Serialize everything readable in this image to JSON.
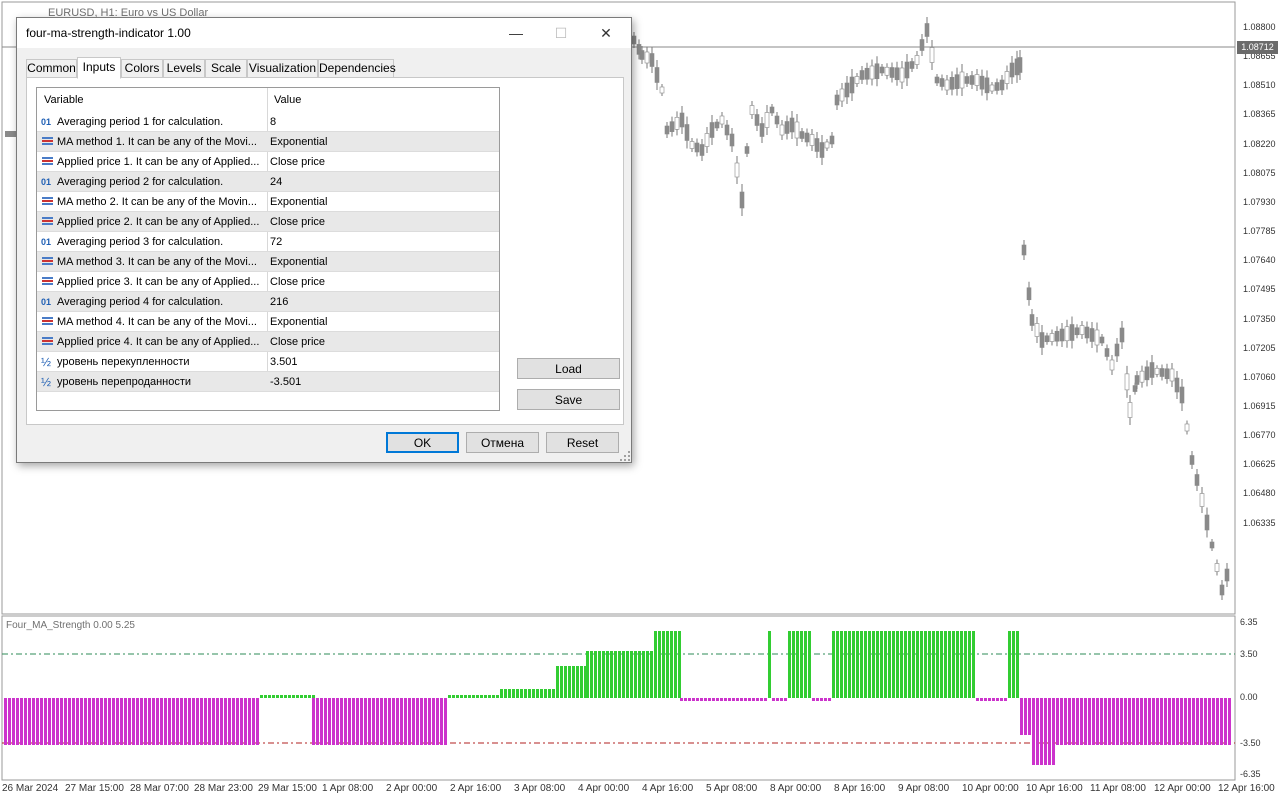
{
  "window": {
    "title": "EURUSD, H1:  Euro vs US Dollar"
  },
  "dialog": {
    "title": "four-ma-strength-indicator 1.00",
    "controls": {
      "minimize": "—",
      "maximize": "☐",
      "close": "✕"
    },
    "tabs": [
      "Common",
      "Inputs",
      "Colors",
      "Levels",
      "Scale",
      "Visualization",
      "Dependencies"
    ],
    "active_tab": "Inputs",
    "grid": {
      "headers": {
        "variable": "Variable",
        "value": "Value"
      },
      "rows": [
        {
          "icon": "integer-icon",
          "name": "Averaging period 1 for calculation.",
          "value": "8"
        },
        {
          "icon": "enum-icon",
          "name": "MA method 1. It can be any of the Movi...",
          "value": "Exponential"
        },
        {
          "icon": "enum-icon",
          "name": "Applied price 1. It can be any of Applied...",
          "value": "Close price"
        },
        {
          "icon": "integer-icon",
          "name": "Averaging period 2 for calculation.",
          "value": "24"
        },
        {
          "icon": "enum-icon",
          "name": "MA metho 2. It can be any of the Movin...",
          "value": "Exponential"
        },
        {
          "icon": "enum-icon",
          "name": "Applied price 2. It can be any of Applied...",
          "value": "Close price"
        },
        {
          "icon": "integer-icon",
          "name": "Averaging period 3 for calculation.",
          "value": "72"
        },
        {
          "icon": "enum-icon",
          "name": "MA method 3. It can be any of the Movi...",
          "value": "Exponential"
        },
        {
          "icon": "enum-icon",
          "name": "Applied price 3. It can be any of Applied...",
          "value": "Close price"
        },
        {
          "icon": "integer-icon",
          "name": "Averaging period 4 for calculation.",
          "value": "216"
        },
        {
          "icon": "enum-icon",
          "name": "MA method 4. It can be any of the Movi...",
          "value": "Exponential"
        },
        {
          "icon": "enum-icon",
          "name": "Applied price 4. It can be any of Applied...",
          "value": "Close price"
        },
        {
          "icon": "double-icon",
          "name": "уровень перекупленности",
          "value": "3.501"
        },
        {
          "icon": "double-icon",
          "name": "уровень перепроданности",
          "value": "-3.501"
        }
      ],
      "icon_text": {
        "integer": "01",
        "double": "½"
      }
    },
    "buttons": {
      "load": "Load",
      "save": "Save",
      "ok": "OK",
      "cancel": "Отмена",
      "reset": "Reset"
    }
  },
  "price_axis": [
    "1.08800",
    "1.08655",
    "1.08510",
    "1.08365",
    "1.08220",
    "1.08075",
    "1.07930",
    "1.07785",
    "1.07640",
    "1.07495",
    "1.07350",
    "1.07205",
    "1.07060",
    "1.06915",
    "1.06770",
    "1.06625",
    "1.06480",
    "1.06335"
  ],
  "current_price": "1.08712",
  "indicator": {
    "label": "Four_MA_Strength 0.00 5.25",
    "axis_labels": [
      "6.35",
      "3.50",
      "0.00",
      "-3.50",
      "-6.35"
    ]
  },
  "time_axis": [
    "26 Mar 2024",
    "27 Mar 15:00",
    "28 Mar 07:00",
    "28 Mar 23:00",
    "29 Mar 15:00",
    "1 Apr 08:00",
    "2 Apr 00:00",
    "2 Apr 16:00",
    "3 Apr 08:00",
    "4 Apr 00:00",
    "4 Apr 16:00",
    "5 Apr 08:00",
    "8 Apr 00:00",
    "8 Apr 16:00",
    "9 Apr 08:00",
    "10 Apr 00:00",
    "10 Apr 16:00",
    "11 Apr 08:00",
    "12 Apr 00:00",
    "12 Apr 16:00"
  ],
  "colors": {
    "bull": "#32cd32",
    "bear": "#cc33cc",
    "candle": "#808080",
    "accent": "#0078d7"
  }
}
